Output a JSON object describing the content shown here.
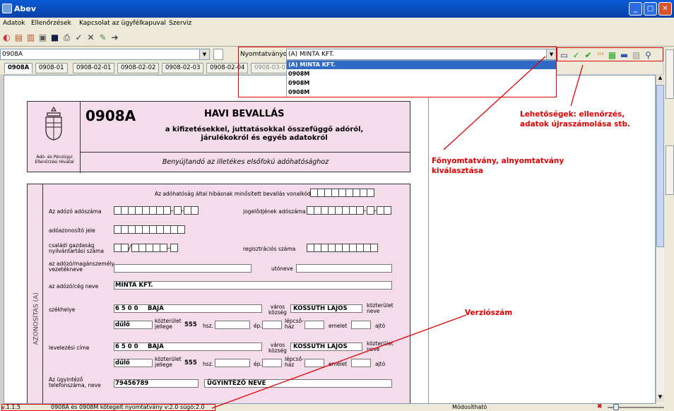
{
  "window": {
    "title": "Abev",
    "btn_min": "_",
    "btn_max": "□",
    "btn_close": "✕"
  },
  "menu": [
    "Adatok",
    "Ellenőrzések",
    "Kapcsolat az ügyfélkapuval",
    "Szerviz"
  ],
  "form_select": {
    "value": "0908A"
  },
  "nyomtatvanyok": {
    "label": "Nyomtatványok",
    "value": "(A) MINTA KFT.",
    "options": [
      "(A) MINTA KFT.",
      "0908M",
      "0908M",
      "0908M"
    ]
  },
  "tabs": [
    "0908A",
    "0908-01",
    "0908-02-01",
    "0908-02-02",
    "0908-02-03",
    "0908-02-04",
    "0908-03-0"
  ],
  "form": {
    "code": "0908A",
    "title": "HAVI BEVALLÁS",
    "subtitle1": "a kifizetésekkel, juttatásokkal összefüggő adóról,",
    "subtitle2": "járulékokról és egyéb adatokról",
    "authority": "Adó- és Pénzügyi Ellenőrzési Hivatal",
    "submit_note": "Benyújtandó az illetékes elsőfokú adóhatósághoz",
    "section_label": "AZONOSÍTÁS (A)",
    "lbl_barcode": "Az adóhatóság által hibásnak minősített bevallás vonalkódja",
    "lbl_taxnum": "Az adózó adószáma",
    "lbl_predecessor": "jogelődjének adószáma",
    "lbl_taxid": "adóazonosító jele",
    "lbl_family": "családi gazdaság nyilvántartási száma",
    "lbl_reg": "regisztrációs száma",
    "lbl_lastname": "az adózó/magánszemély vezetékneve",
    "lbl_firstname": "utóneve",
    "lbl_name": "az adózó/cég neve",
    "val_name": "MINTA KFT.",
    "lbl_seat": "székhelye",
    "lbl_mail": "levelezési címe",
    "val_zip": "6 5 0 0",
    "val_city": "BAJA",
    "lbl_varos": "város község",
    "val_street": "KOSSUTH LAJOS",
    "lbl_kozter_neve": "közterület neve",
    "val_type": "dűlő",
    "lbl_kozter_jellege": "közterület jellege",
    "val_hsz": "555",
    "lbl_hsz": "hsz.",
    "lbl_ep": "ép.",
    "lbl_lepcso": "lépcső-ház",
    "lbl_emelet": "emelet",
    "lbl_ajto": "ajtó",
    "lbl_agent": "Az ügyintéző telefonszáma, neve",
    "val_phone": "79456789",
    "val_agent": "ÜGYINTÉZŐ NEVE"
  },
  "annotations": {
    "options": "Lehetőségek: ellenőrzés, adatok újraszámolása stb.",
    "mainform": "Főnyomtatvány, alnyomtatvány kiválasztása",
    "version": "Verziószám"
  },
  "status": {
    "version": "v.1.1.5",
    "info": "0908A és 0908M kötegelt nyomtatvány v:2.0 súgó:2.0",
    "mode": "Módosítható"
  },
  "colors": {
    "title_blue": "#0a5bd6",
    "form_pink": "#f5dcea",
    "annotation_red": "#e00000"
  }
}
